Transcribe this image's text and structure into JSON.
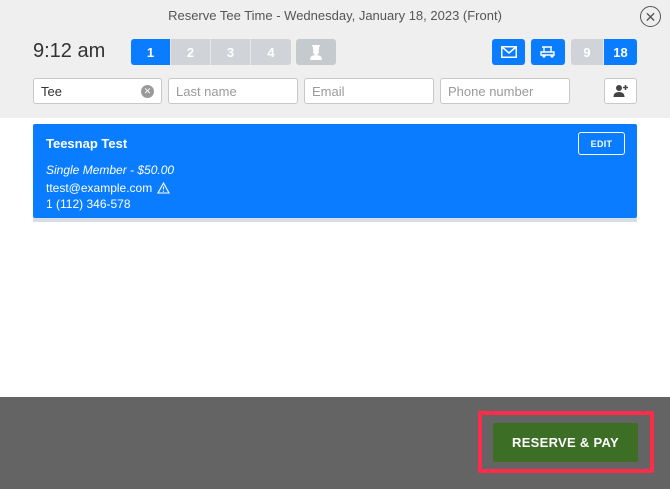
{
  "modal": {
    "title": "Reserve Tee Time - Wednesday, January 18, 2023 (Front)",
    "time": "9:12 am"
  },
  "players": {
    "options": [
      "1",
      "2",
      "3",
      "4"
    ],
    "selected": "1"
  },
  "holes": {
    "options": [
      "9",
      "18"
    ],
    "selected": "18"
  },
  "icons": {
    "member": "member-silhouette-icon",
    "mail": "envelope-icon",
    "cart": "golf-cart-icon",
    "close": "close-icon",
    "add_player": "add-person-icon",
    "warning": "warning-triangle-icon",
    "clear": "clear-input-icon"
  },
  "form": {
    "first_name": {
      "value": "Tee",
      "placeholder": ""
    },
    "last_name": {
      "value": "",
      "placeholder": "Last name"
    },
    "email": {
      "value": "",
      "placeholder": "Email"
    },
    "phone": {
      "value": "",
      "placeholder": "Phone number"
    }
  },
  "player_card": {
    "name": "Teesnap Test",
    "type": "Single Member - $50.00",
    "email": "ttest@example.com",
    "phone": "1 (112) 346-578",
    "edit_label": "EDIT"
  },
  "footer": {
    "reserve_label": "RESERVE & PAY"
  },
  "colors": {
    "accent": "#0a7cff",
    "reserve": "#3c6e26",
    "highlight": "#ff2b4a",
    "footer_bg": "#646464"
  }
}
